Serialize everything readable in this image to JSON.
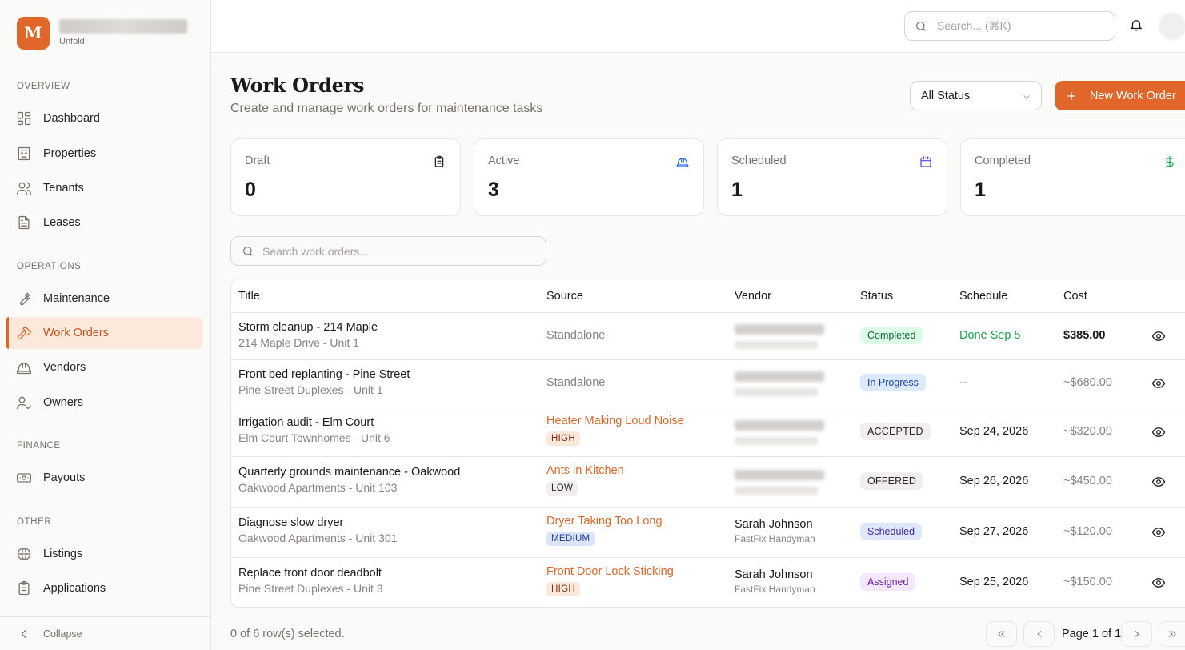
{
  "brand": {
    "logo_letter": "M",
    "subtitle": "Unfold"
  },
  "topbar": {
    "search_placeholder": "Search... (⌘K)"
  },
  "sidebar": {
    "sections": {
      "overview": "OVERVIEW",
      "operations": "OPERATIONS",
      "finance": "FINANCE",
      "other": "OTHER"
    },
    "items": {
      "dashboard": "Dashboard",
      "properties": "Properties",
      "tenants": "Tenants",
      "leases": "Leases",
      "maintenance": "Maintenance",
      "work_orders": "Work Orders",
      "vendors": "Vendors",
      "owners": "Owners",
      "payouts": "Payouts",
      "listings": "Listings",
      "applications": "Applications"
    },
    "collapse": "Collapse"
  },
  "page": {
    "title": "Work Orders",
    "subtitle": "Create and manage work orders for maintenance tasks",
    "status_filter": "All Status",
    "new_button": "New Work Order"
  },
  "stats": [
    {
      "label": "Draft",
      "value": "0",
      "icon": "clipboard-icon",
      "color": "#1c1917"
    },
    {
      "label": "Active",
      "value": "3",
      "icon": "hard-hat-icon",
      "color": "#2563eb"
    },
    {
      "label": "Scheduled",
      "value": "1",
      "icon": "calendar-icon",
      "color": "#4f46e5"
    },
    {
      "label": "Completed",
      "value": "1",
      "icon": "dollar-icon",
      "color": "#16a34a"
    }
  ],
  "table": {
    "search_placeholder": "Search work orders...",
    "headers": {
      "title": "Title",
      "source": "Source",
      "vendor": "Vendor",
      "status": "Status",
      "schedule": "Schedule",
      "cost": "Cost"
    },
    "rows": [
      {
        "title": "Storm cleanup - 214 Maple",
        "location": "214 Maple Drive - Unit 1",
        "source": "Standalone",
        "priority": "",
        "vendor_name": "",
        "vendor_company": "",
        "status": "Completed",
        "schedule": "Done Sep 5",
        "cost": "$385.00"
      },
      {
        "title": "Front bed replanting - Pine Street",
        "location": "Pine Street Duplexes - Unit 1",
        "source": "Standalone",
        "priority": "",
        "vendor_name": "",
        "vendor_company": "",
        "status": "In Progress",
        "schedule": "--",
        "cost": "~$680.00"
      },
      {
        "title": "Irrigation audit - Elm Court",
        "location": "Elm Court Townhomes - Unit 6",
        "source": "Heater Making Loud Noise",
        "priority": "HIGH",
        "vendor_name": "",
        "vendor_company": "",
        "status": "ACCEPTED",
        "schedule": "Sep 24, 2026",
        "cost": "~$320.00"
      },
      {
        "title": "Quarterly grounds maintenance - Oakwood",
        "location": "Oakwood Apartments - Unit 103",
        "source": "Ants in Kitchen",
        "priority": "LOW",
        "vendor_name": "",
        "vendor_company": "",
        "status": "OFFERED",
        "schedule": "Sep 26, 2026",
        "cost": "~$450.00"
      },
      {
        "title": "Diagnose slow dryer",
        "location": "Oakwood Apartments - Unit 301",
        "source": "Dryer Taking Too Long",
        "priority": "MEDIUM",
        "vendor_name": "Sarah Johnson",
        "vendor_company": "FastFix Handyman",
        "status": "Scheduled",
        "schedule": "Sep 27, 2026",
        "cost": "~$120.00"
      },
      {
        "title": "Replace front door deadbolt",
        "location": "Pine Street Duplexes - Unit 3",
        "source": "Front Door Lock Sticking",
        "priority": "HIGH",
        "vendor_name": "Sarah Johnson",
        "vendor_company": "FastFix Handyman",
        "status": "Assigned",
        "schedule": "Sep 25, 2026",
        "cost": "~$150.00"
      }
    ],
    "selection": "0 of 6 row(s) selected.",
    "pagination": "Page 1 of 1"
  }
}
